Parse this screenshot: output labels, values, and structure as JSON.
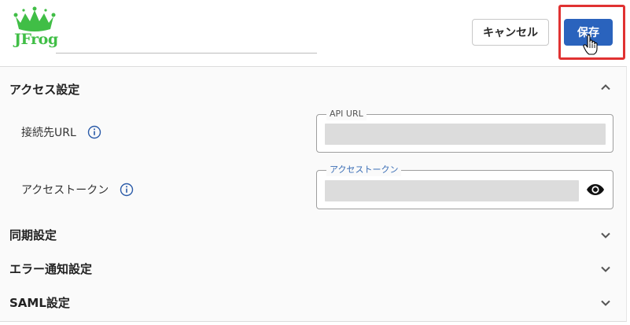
{
  "header": {
    "logo_text": "JFrog",
    "cancel_label": "キャンセル",
    "save_label": "保存"
  },
  "sections": {
    "access": {
      "title": "アクセス設定",
      "url_label": "接続先URL",
      "url_field_legend": "API URL",
      "token_label": "アクセストークン",
      "token_field_legend": "アクセストークン"
    },
    "sync": {
      "title": "同期設定"
    },
    "error": {
      "title": "エラー通知設定"
    },
    "saml": {
      "title": "SAML設定"
    }
  },
  "colors": {
    "brand_green": "#40be46",
    "primary_blue": "#2a63bd",
    "highlight_red": "#e03232",
    "legend_blue": "#3a6db5",
    "legend_gray": "#555555"
  }
}
